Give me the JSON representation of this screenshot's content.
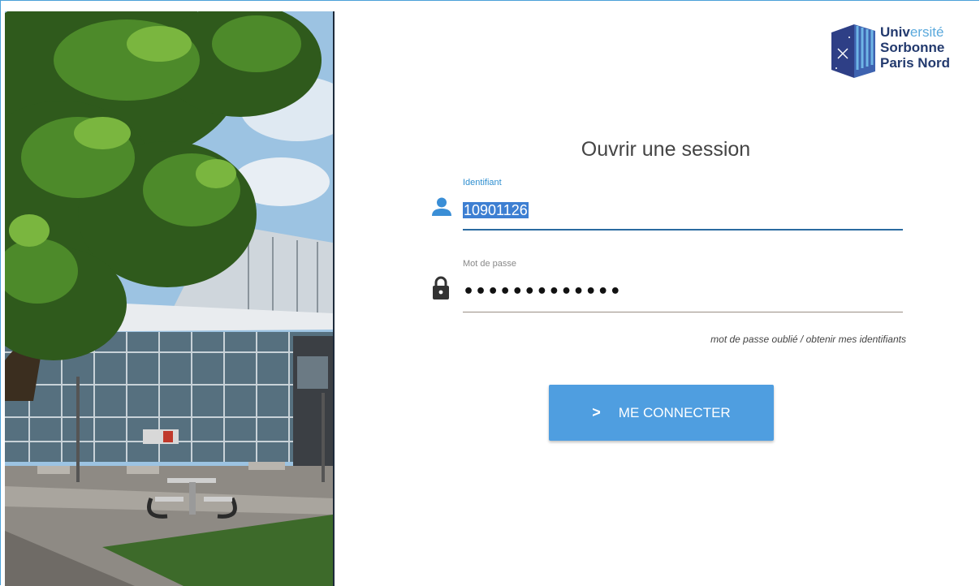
{
  "logo": {
    "line1_a": "Univ",
    "line1_b": "ersité",
    "line2": "Sorbonne",
    "line3": "Paris Nord"
  },
  "form": {
    "title": "Ouvrir une session",
    "username_label": "Identifiant",
    "username_value": "10901126",
    "password_label": "Mot de passe",
    "password_mask": "•••••••••••••",
    "forgot_link": "mot de passe oublié",
    "separator": "/",
    "get_ids_link": "obtenir mes identifiants",
    "submit_icon": ">",
    "submit_label": "ME CONNECTER"
  },
  "icons": {
    "user": "user-icon",
    "lock": "lock-icon",
    "chevron": "chevron-right-icon"
  },
  "colors": {
    "accent": "#4f9ee0",
    "label_active": "#2f8fd0",
    "selection": "#3d7fd2",
    "brand_dark": "#233a6e",
    "brand_light": "#5aa9dc"
  }
}
